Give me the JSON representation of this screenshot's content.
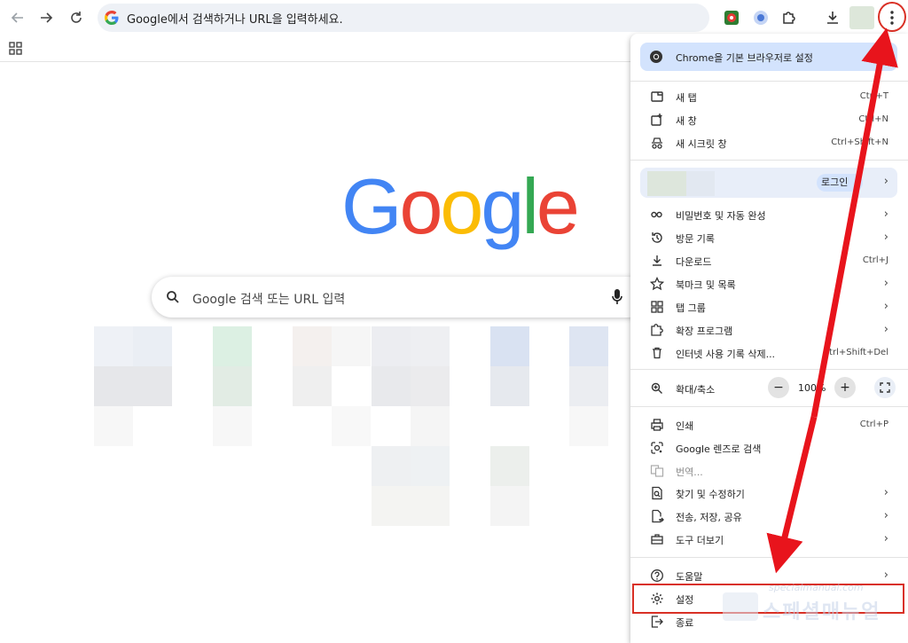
{
  "toolbar": {
    "address_text": "Google에서 검색하거나 URL을 입력하세요."
  },
  "google": {
    "logo_letters": [
      "G",
      "o",
      "o",
      "g",
      "l",
      "e"
    ],
    "logo_colors": [
      "#4285F4",
      "#EA4335",
      "#FBBC05",
      "#4285F4",
      "#34A853",
      "#EA4335"
    ],
    "search_placeholder": "Google 검색 또는 URL 입력"
  },
  "menu": {
    "default_banner": "Chrome을 기본 브라우저로 설정",
    "group1": [
      {
        "label": "새 탭",
        "shortcut": "Ctrl+T",
        "icon": "new-tab-icon"
      },
      {
        "label": "새 창",
        "shortcut": "Ctrl+N",
        "icon": "new-window-icon"
      },
      {
        "label": "새 시크릿 창",
        "shortcut": "Ctrl+Shift+N",
        "icon": "incognito-icon"
      }
    ],
    "login_label": "로그인",
    "group2": [
      {
        "label": "비밀번호 및 자동 완성",
        "icon": "key-icon",
        "submenu": true
      },
      {
        "label": "방문 기록",
        "icon": "history-icon",
        "submenu": true
      },
      {
        "label": "다운로드",
        "shortcut": "Ctrl+J",
        "icon": "download-icon"
      },
      {
        "label": "북마크 및 목록",
        "icon": "star-icon",
        "submenu": true
      },
      {
        "label": "탭 그룹",
        "icon": "tab-groups-icon",
        "submenu": true
      },
      {
        "label": "확장 프로그램",
        "icon": "puzzle-icon",
        "submenu": true
      },
      {
        "label": "인터넷 사용 기록 삭제...",
        "shortcut": "Ctrl+Shift+Del",
        "icon": "trash-icon"
      }
    ],
    "zoom_label": "확대/축소",
    "zoom_value": "100%",
    "zoom_minus": "−",
    "zoom_plus": "+",
    "group3": [
      {
        "label": "인쇄",
        "shortcut": "Ctrl+P",
        "icon": "print-icon"
      },
      {
        "label": "Google 렌즈로 검색",
        "icon": "lens-icon"
      },
      {
        "label": "번역...",
        "icon": "translate-icon",
        "disabled": true
      },
      {
        "label": "찾기 및 수정하기",
        "icon": "find-icon",
        "submenu": true
      },
      {
        "label": "전송, 저장, 공유",
        "icon": "share-icon",
        "submenu": true
      },
      {
        "label": "도구 더보기",
        "icon": "toolbox-icon",
        "submenu": true
      }
    ],
    "group4": [
      {
        "label": "도움말",
        "icon": "help-icon",
        "submenu": true
      },
      {
        "label": "설정",
        "icon": "settings-gear-icon"
      },
      {
        "label": "종료",
        "icon": "exit-icon"
      }
    ],
    "arrow_glyph": "›"
  },
  "watermark": {
    "url": "specialmanual.com",
    "text": "스페셜매뉴얼"
  },
  "colors": {
    "highlight_red": "#d93025",
    "annotation_arrow": "#e8141c",
    "banner_blue": "#d3e3fd"
  }
}
